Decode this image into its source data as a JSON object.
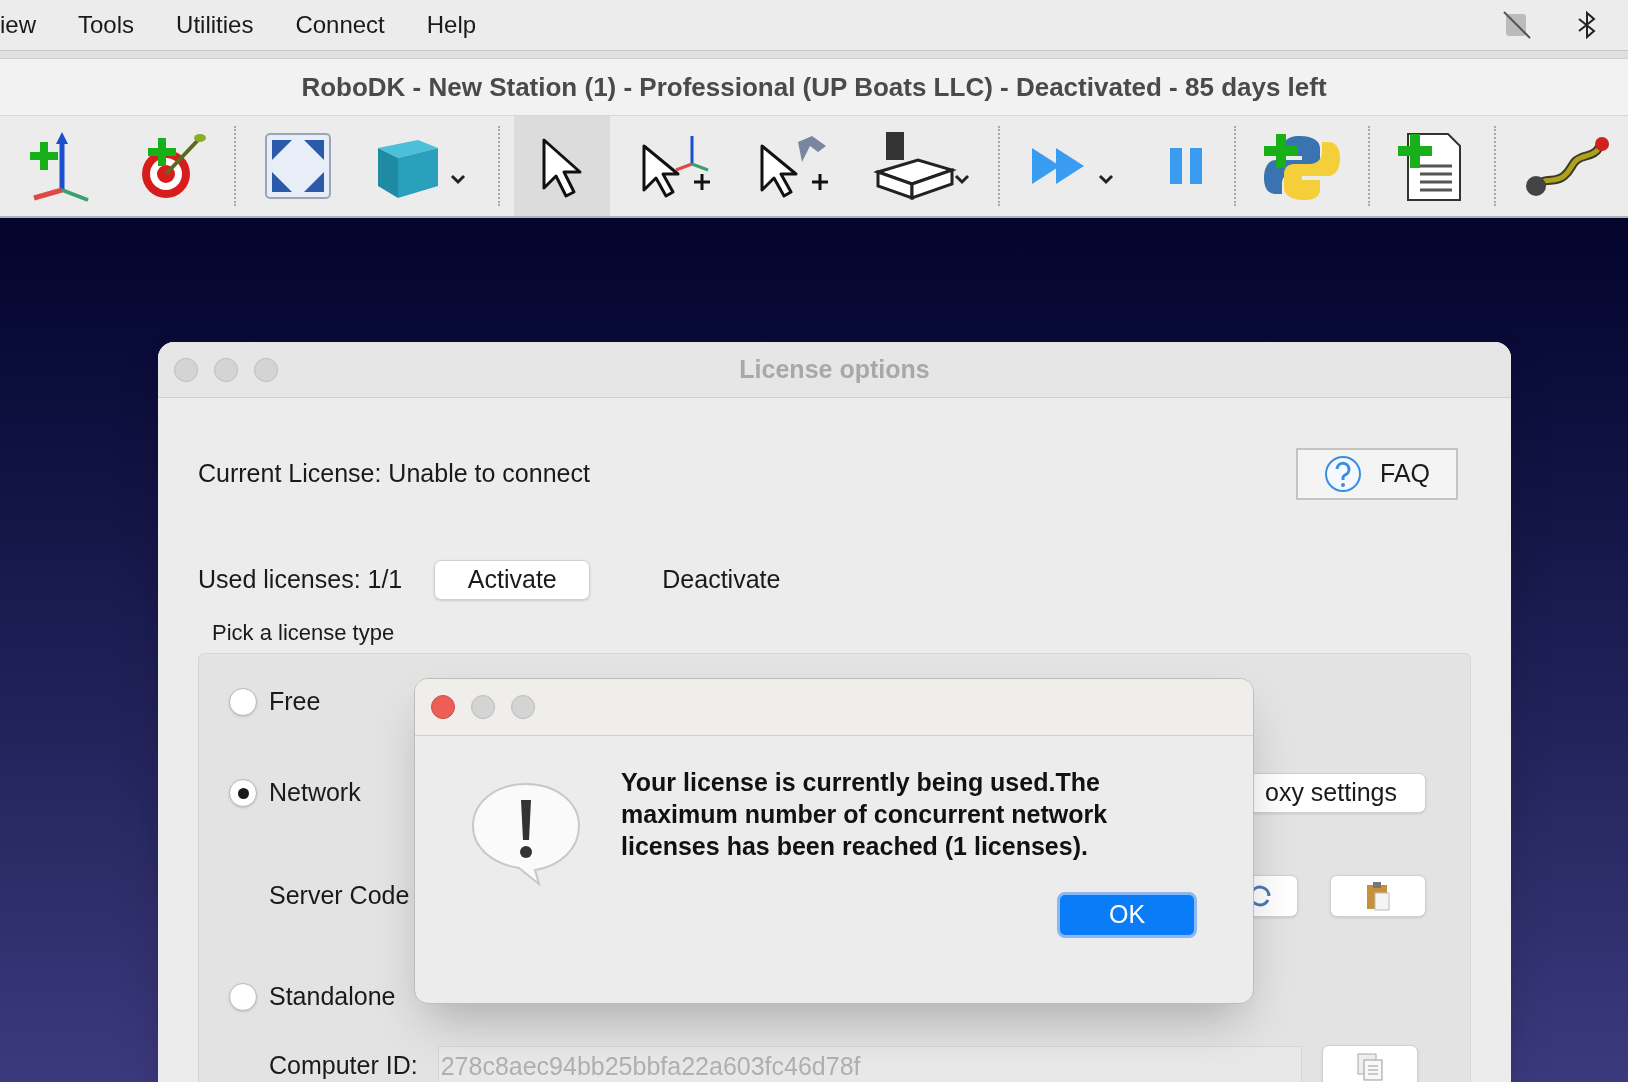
{
  "menu_bar": {
    "items": [
      "iew",
      "Tools",
      "Utilities",
      "Connect",
      "Help"
    ]
  },
  "window": {
    "title": "RoboDK - New Station (1) - Professional (UP Boats LLC) - Deactivated - 85 days left"
  },
  "toolbar": {
    "tools": [
      {
        "kind": "frame",
        "selected": false
      },
      {
        "kind": "target",
        "selected": false
      },
      {
        "kind": "fit",
        "selected": false
      },
      {
        "kind": "cube",
        "selected": false
      },
      {
        "kind": "pointer",
        "selected": true
      },
      {
        "kind": "move-frame",
        "selected": false
      },
      {
        "kind": "move-robot",
        "selected": false
      },
      {
        "kind": "tool",
        "selected": false
      },
      {
        "kind": "run",
        "selected": false
      },
      {
        "kind": "pause",
        "selected": false
      },
      {
        "kind": "python",
        "selected": false
      },
      {
        "kind": "program",
        "selected": false
      },
      {
        "kind": "path",
        "selected": false
      }
    ]
  },
  "license_dialog": {
    "title": "License options",
    "current_license": "Current License: Unable to connect",
    "faq_button": "FAQ",
    "used_licenses": "Used licenses: 1/1",
    "activate_button": "Activate",
    "deactivate_button": "Deactivate",
    "group_title": "Pick a license type",
    "options": [
      {
        "label": "Free",
        "selected": false
      },
      {
        "label": "Network",
        "selected": true
      },
      {
        "label": "Standalone",
        "selected": false
      }
    ],
    "proxy_button": "oxy settings",
    "server_code_label": "Server Code",
    "computer_id_label": "Computer ID:",
    "computer_id_value": "278c8aec94bb25bbfa22a603fc46d78f"
  },
  "alert": {
    "message": "Your license is currently being used.The maximum number of concurrent network licenses has been reached (1 licenses).",
    "ok_button": "OK"
  }
}
